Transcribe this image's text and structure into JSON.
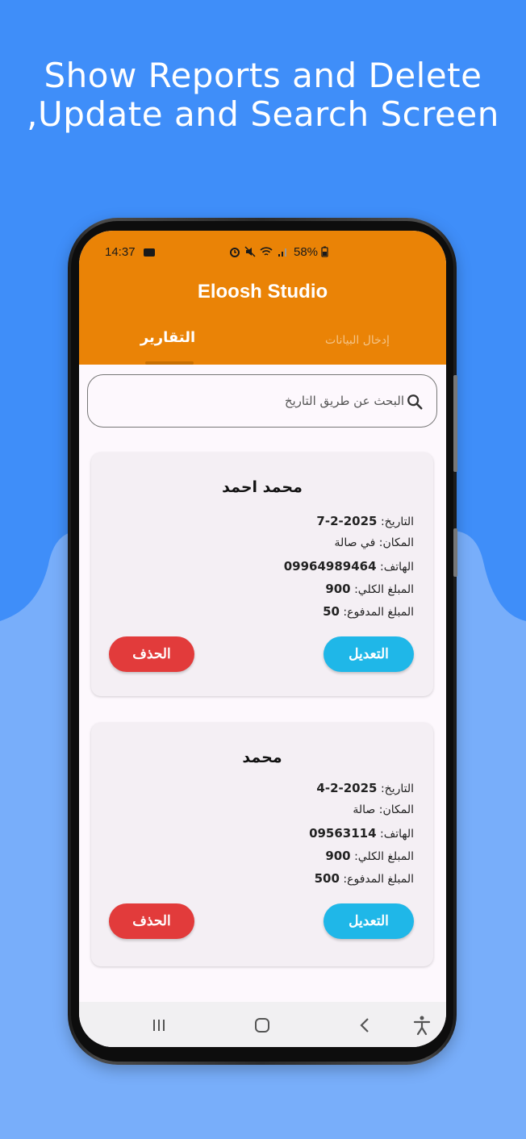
{
  "headline": {
    "line1": "Show Reports and Delete",
    "line2": ",Update and Search Screen"
  },
  "colors": {
    "background": "#3f8ef9",
    "background_wave": "#78aefa",
    "app_bar": "#ea8306",
    "edit_button": "#1fb7e8",
    "delete_button": "#e23b3b"
  },
  "status_bar": {
    "time": "14:37",
    "battery": "58%",
    "icons": [
      "video-record-icon",
      "alarm-icon",
      "mute-icon",
      "wifi-icon",
      "signal-icon",
      "battery-icon"
    ]
  },
  "app": {
    "title": "Eloosh Studio",
    "tabs": [
      {
        "label": "التقارير",
        "selected": true
      },
      {
        "label": "إدخال البيانات",
        "selected": false
      }
    ]
  },
  "search": {
    "placeholder": "البحث عن طريق التاريخ",
    "value": "",
    "icon": "search-icon"
  },
  "reports": [
    {
      "name": "محمد احمد",
      "date_label": "التاريخ:",
      "date": "7-2-2025",
      "place_label": "المكان:",
      "place": "في صالة",
      "phone_label": "الهاتف:",
      "phone": "09964989464",
      "total_label": "المبلغ الكلي:",
      "total": "900",
      "paid_label": "المبلغ المدفوع:",
      "paid": "50",
      "edit_label": "التعديل",
      "delete_label": "الحذف"
    },
    {
      "name": "محمد",
      "date_label": "التاريخ:",
      "date": "4-2-2025",
      "place_label": "المكان:",
      "place": "صالة",
      "phone_label": "الهاتف:",
      "phone": "09563114",
      "total_label": "المبلغ الكلي:",
      "total": "900",
      "paid_label": "المبلغ المدفوع:",
      "paid": "500",
      "edit_label": "التعديل",
      "delete_label": "الحذف"
    }
  ],
  "nav_bar": {
    "icons": [
      "recent-apps-icon",
      "home-icon",
      "back-icon",
      "accessibility-icon"
    ]
  }
}
